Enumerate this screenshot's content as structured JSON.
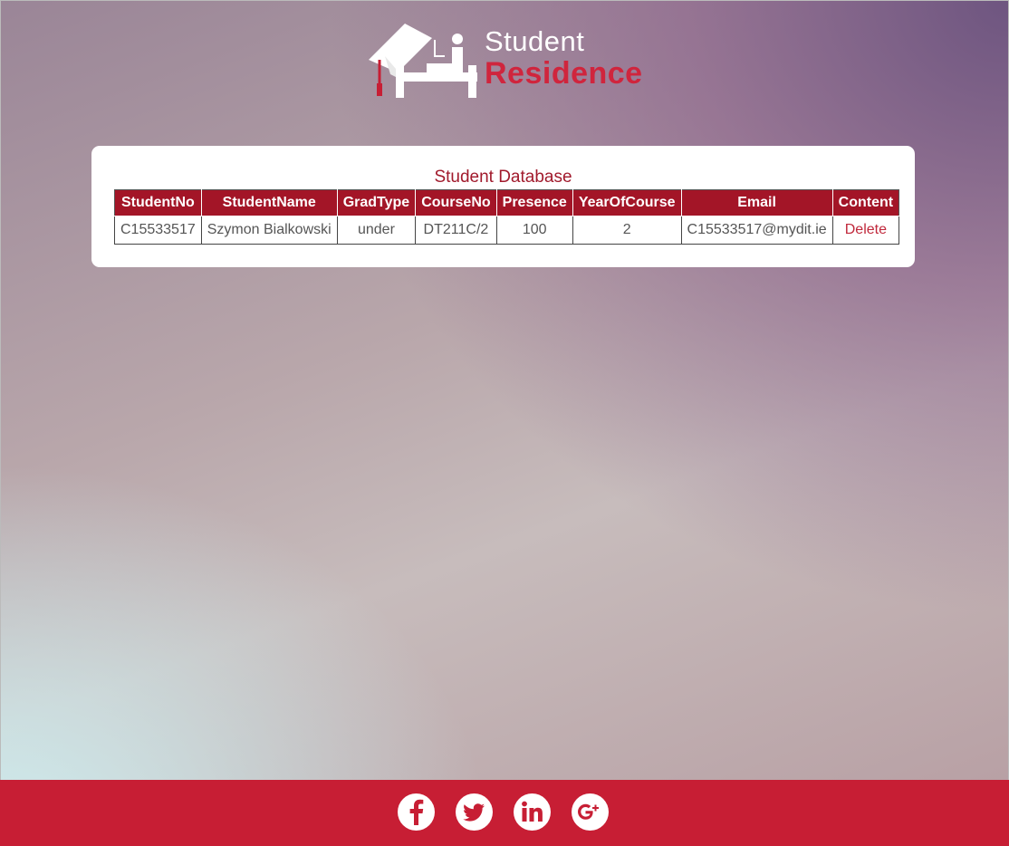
{
  "logo": {
    "line1": "Student",
    "line2": "Residence"
  },
  "table": {
    "caption": "Student Database",
    "headers": [
      "StudentNo",
      "StudentName",
      "GradType",
      "CourseNo",
      "Presence",
      "YearOfCourse",
      "Email",
      "Content"
    ],
    "rows": [
      {
        "student_no": "C15533517",
        "student_name": "Szymon Bialkowski",
        "grad_type": "under",
        "course_no": "DT211C/2",
        "presence": "100",
        "year_of_course": "2",
        "email": "C15533517@mydit.ie",
        "action": "Delete"
      }
    ]
  },
  "footer": {
    "social_icons": [
      "facebook-icon",
      "twitter-icon",
      "linkedin-icon",
      "google-plus-icon"
    ]
  },
  "colors": {
    "brand_red": "#c71e34",
    "header_red": "#a31527",
    "caption_red": "#a11a2c"
  }
}
